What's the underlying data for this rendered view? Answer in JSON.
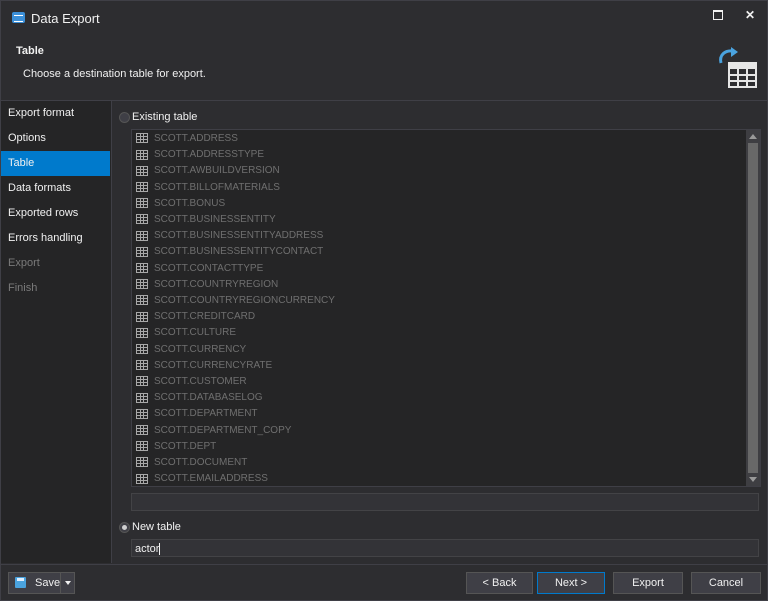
{
  "window": {
    "title": "Data Export"
  },
  "header": {
    "title": "Table",
    "description": "Choose a destination table for export."
  },
  "nav": {
    "items": [
      {
        "label": "Export format",
        "state": "normal"
      },
      {
        "label": "Options",
        "state": "normal"
      },
      {
        "label": "Table",
        "state": "active"
      },
      {
        "label": "Data formats",
        "state": "normal"
      },
      {
        "label": "Exported rows",
        "state": "normal"
      },
      {
        "label": "Errors handling",
        "state": "normal"
      },
      {
        "label": "Export",
        "state": "disabled"
      },
      {
        "label": "Finish",
        "state": "disabled"
      }
    ]
  },
  "existing": {
    "label": "Existing table",
    "selected": false,
    "tables": [
      "SCOTT.ADDRESS",
      "SCOTT.ADDRESSTYPE",
      "SCOTT.AWBUILDVERSION",
      "SCOTT.BILLOFMATERIALS",
      "SCOTT.BONUS",
      "SCOTT.BUSINESSENTITY",
      "SCOTT.BUSINESSENTITYADDRESS",
      "SCOTT.BUSINESSENTITYCONTACT",
      "SCOTT.CONTACTTYPE",
      "SCOTT.COUNTRYREGION",
      "SCOTT.COUNTRYREGIONCURRENCY",
      "SCOTT.CREDITCARD",
      "SCOTT.CULTURE",
      "SCOTT.CURRENCY",
      "SCOTT.CURRENCYRATE",
      "SCOTT.CUSTOMER",
      "SCOTT.DATABASELOG",
      "SCOTT.DEPARTMENT",
      "SCOTT.DEPARTMENT_COPY",
      "SCOTT.DEPT",
      "SCOTT.DOCUMENT",
      "SCOTT.EMAILADDRESS"
    ],
    "filter_value": ""
  },
  "new_table": {
    "label": "New table",
    "selected": true,
    "value": "actor"
  },
  "buttons": {
    "save": "Save",
    "back": "< Back",
    "next": "Next >",
    "export": "Export",
    "cancel": "Cancel"
  },
  "icons": {
    "app": "data-export-icon",
    "header": "table-export-icon",
    "table": "table-grid-icon",
    "save": "floppy-disk-icon"
  }
}
